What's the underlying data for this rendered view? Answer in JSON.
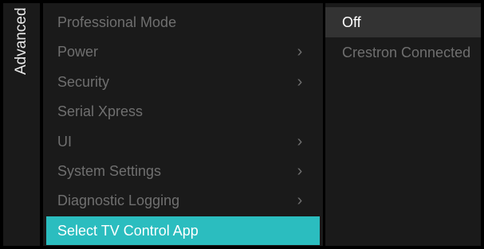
{
  "side_tab": {
    "label": "Advanced"
  },
  "menu": {
    "items": [
      {
        "label": "Professional Mode",
        "has_submenu": false
      },
      {
        "label": "Power",
        "has_submenu": true
      },
      {
        "label": "Security",
        "has_submenu": true
      },
      {
        "label": "Serial Xpress",
        "has_submenu": false
      },
      {
        "label": "UI",
        "has_submenu": true
      },
      {
        "label": "System Settings",
        "has_submenu": true
      },
      {
        "label": "Diagnostic Logging",
        "has_submenu": true
      },
      {
        "label": "Select TV Control App",
        "has_submenu": false,
        "selected": true
      }
    ],
    "chevron_glyph": "›"
  },
  "options": {
    "items": [
      {
        "label": "Off",
        "active": true
      },
      {
        "label": "Crestron Connected",
        "active": false
      }
    ]
  },
  "colors": {
    "highlight": "#2bbdbf",
    "panel": "#1a1a1a",
    "dim_text": "#6f6f6f",
    "active_option_bg": "#333333"
  }
}
